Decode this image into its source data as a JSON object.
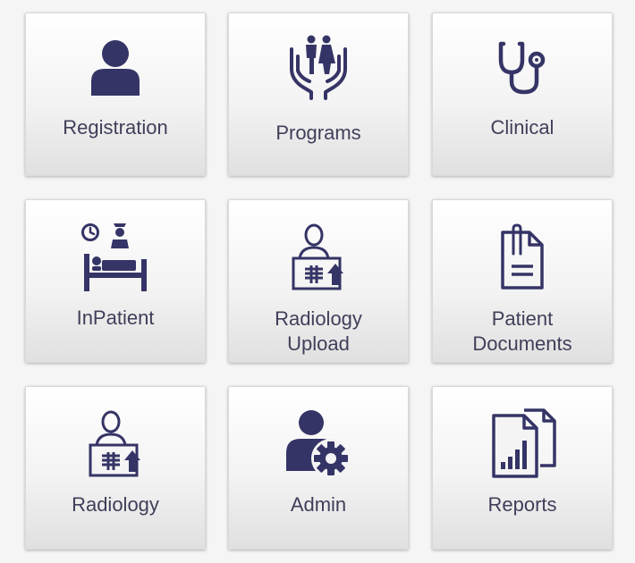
{
  "colors": {
    "icon": "#353466",
    "label": "#3f3f5a",
    "tile_top": "#ffffff",
    "tile_bottom": "#e0e0e0"
  },
  "tiles": [
    {
      "label": "Registration",
      "icon": "user-icon"
    },
    {
      "label": "Programs",
      "icon": "family-hands-icon"
    },
    {
      "label": "Clinical",
      "icon": "stethoscope-icon"
    },
    {
      "label": "InPatient",
      "icon": "hospital-bed-icon"
    },
    {
      "label": "Radiology",
      "label2": "Upload",
      "icon": "xray-upload-icon"
    },
    {
      "label": "Patient",
      "label2": "Documents",
      "icon": "document-clip-icon"
    },
    {
      "label": "Radiology",
      "icon": "xray-icon"
    },
    {
      "label": "Admin",
      "icon": "admin-gear-icon"
    },
    {
      "label": "Reports",
      "icon": "reports-icon"
    }
  ]
}
